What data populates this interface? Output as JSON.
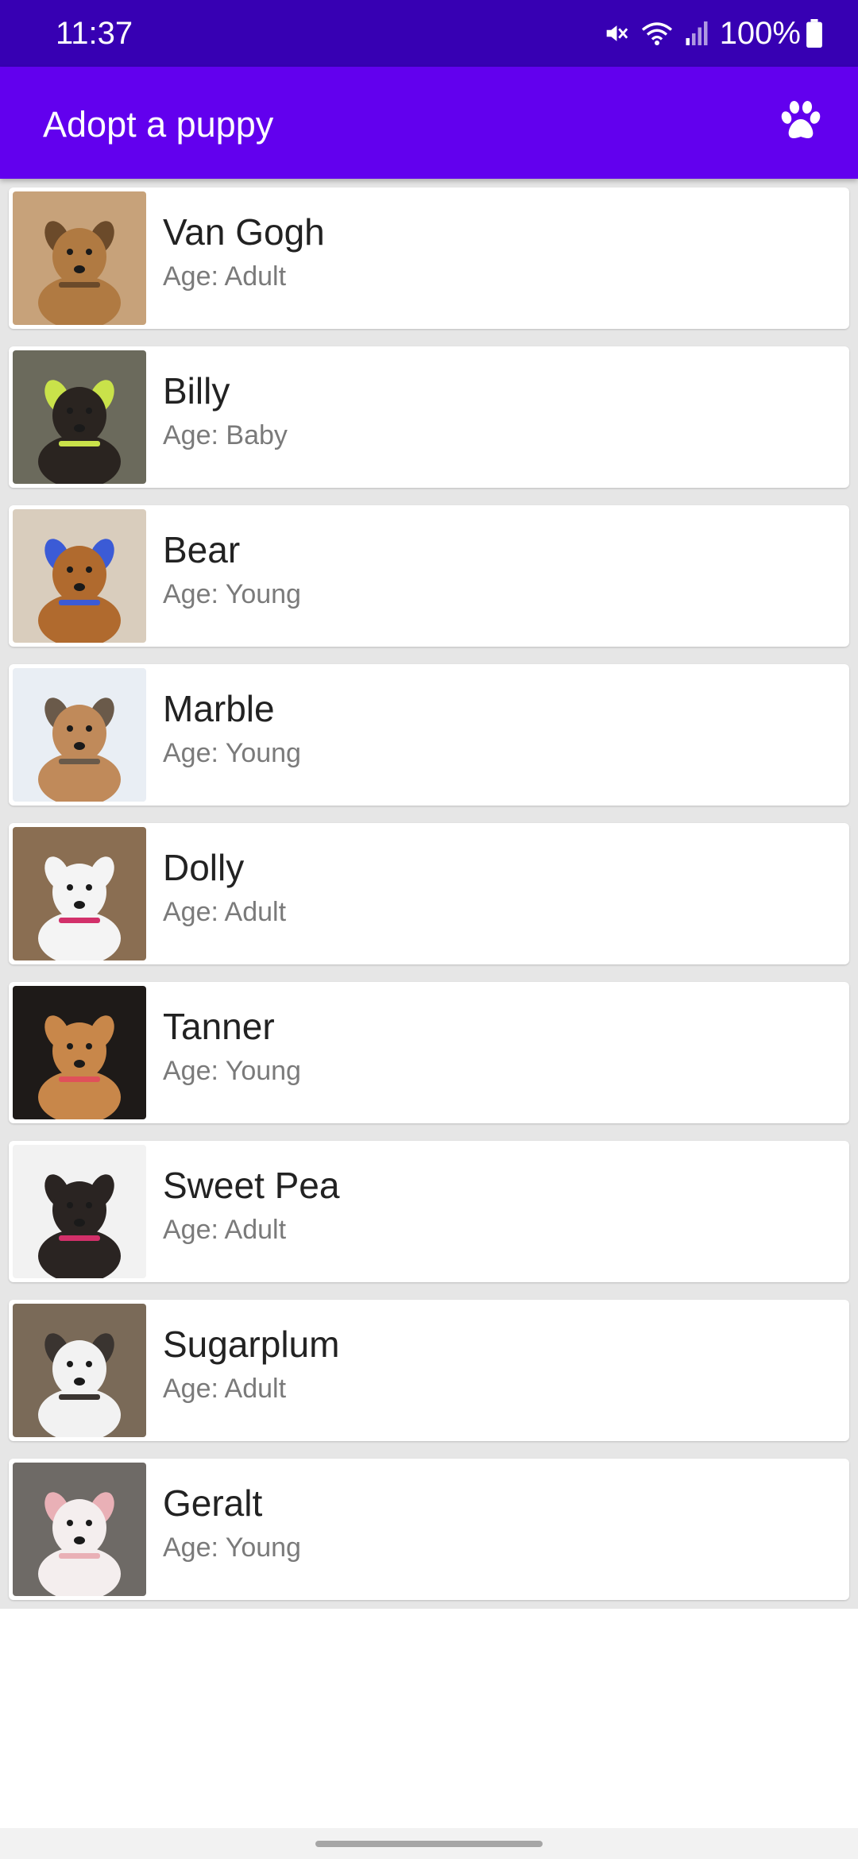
{
  "status_bar": {
    "time": "11:37",
    "battery": "100%",
    "icons": [
      "mute-icon",
      "wifi-icon",
      "signal-icon",
      "battery-icon"
    ]
  },
  "app_bar": {
    "title": "Adopt a puppy",
    "action_icon": "paw-icon",
    "color": "#6200ee"
  },
  "puppies": [
    {
      "name": "Van Gogh",
      "age": "Age: Adult",
      "photo": {
        "bg": "#c7a27a",
        "fg": "#b07a42",
        "accent": "#6b4a2a"
      }
    },
    {
      "name": "Billy",
      "age": "Age: Baby",
      "photo": {
        "bg": "#6b6a5c",
        "fg": "#2a2420",
        "accent": "#c9e24a"
      }
    },
    {
      "name": "Bear",
      "age": "Age: Young",
      "photo": {
        "bg": "#d9cdbd",
        "fg": "#b06a2e",
        "accent": "#3b5bd6"
      }
    },
    {
      "name": "Marble",
      "age": "Age: Young",
      "photo": {
        "bg": "#e9eef4",
        "fg": "#c08a5a",
        "accent": "#6a5a4a"
      }
    },
    {
      "name": "Dolly",
      "age": "Age: Adult",
      "photo": {
        "bg": "#8a6e52",
        "fg": "#f4f4f4",
        "accent": "#d2306a"
      }
    },
    {
      "name": "Tanner",
      "age": "Age: Young",
      "photo": {
        "bg": "#1e1a18",
        "fg": "#c8874a",
        "accent": "#e0505a"
      }
    },
    {
      "name": "Sweet Pea",
      "age": "Age: Adult",
      "photo": {
        "bg": "#f2f2f2",
        "fg": "#2a2422",
        "accent": "#d2306a"
      }
    },
    {
      "name": "Sugarplum",
      "age": "Age: Adult",
      "photo": {
        "bg": "#7a6a58",
        "fg": "#f2f2f2",
        "accent": "#3a3430"
      }
    },
    {
      "name": "Geralt",
      "age": "Age: Young",
      "photo": {
        "bg": "#6e6a66",
        "fg": "#f4eeee",
        "accent": "#e9b0b6"
      }
    }
  ]
}
